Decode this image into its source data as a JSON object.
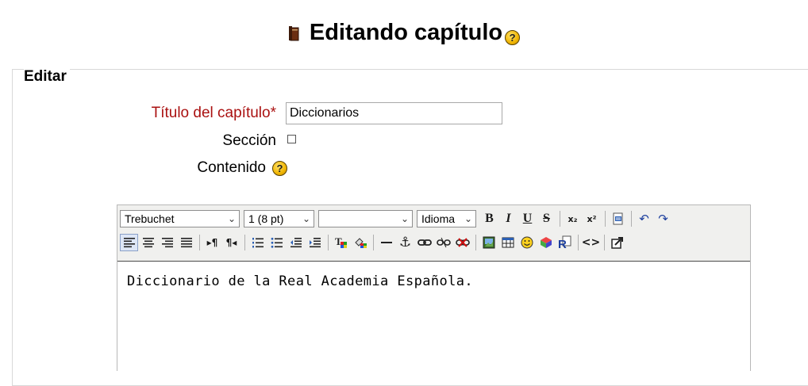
{
  "header": {
    "title": "Editando capítulo",
    "help_glyph": "?"
  },
  "form": {
    "legend": "Editar",
    "title_label": "Título del capítulo",
    "required_mark": "*",
    "title_value": "Diccionarios",
    "section_label": "Sección",
    "section_checked": false,
    "content_label": "Contenido"
  },
  "editor": {
    "font_family": "Trebuchet",
    "font_size": "1 (8 pt)",
    "format": "",
    "language": "Idioma",
    "content_text": "Diccionario de la Real Academia Española."
  },
  "icons": {
    "book": "book-icon",
    "help": "help-icon"
  },
  "colors": {
    "required_label": "#aa1111",
    "help_icon": "#f0b400",
    "editor_toolbar_bg": "#f0f0ee"
  }
}
